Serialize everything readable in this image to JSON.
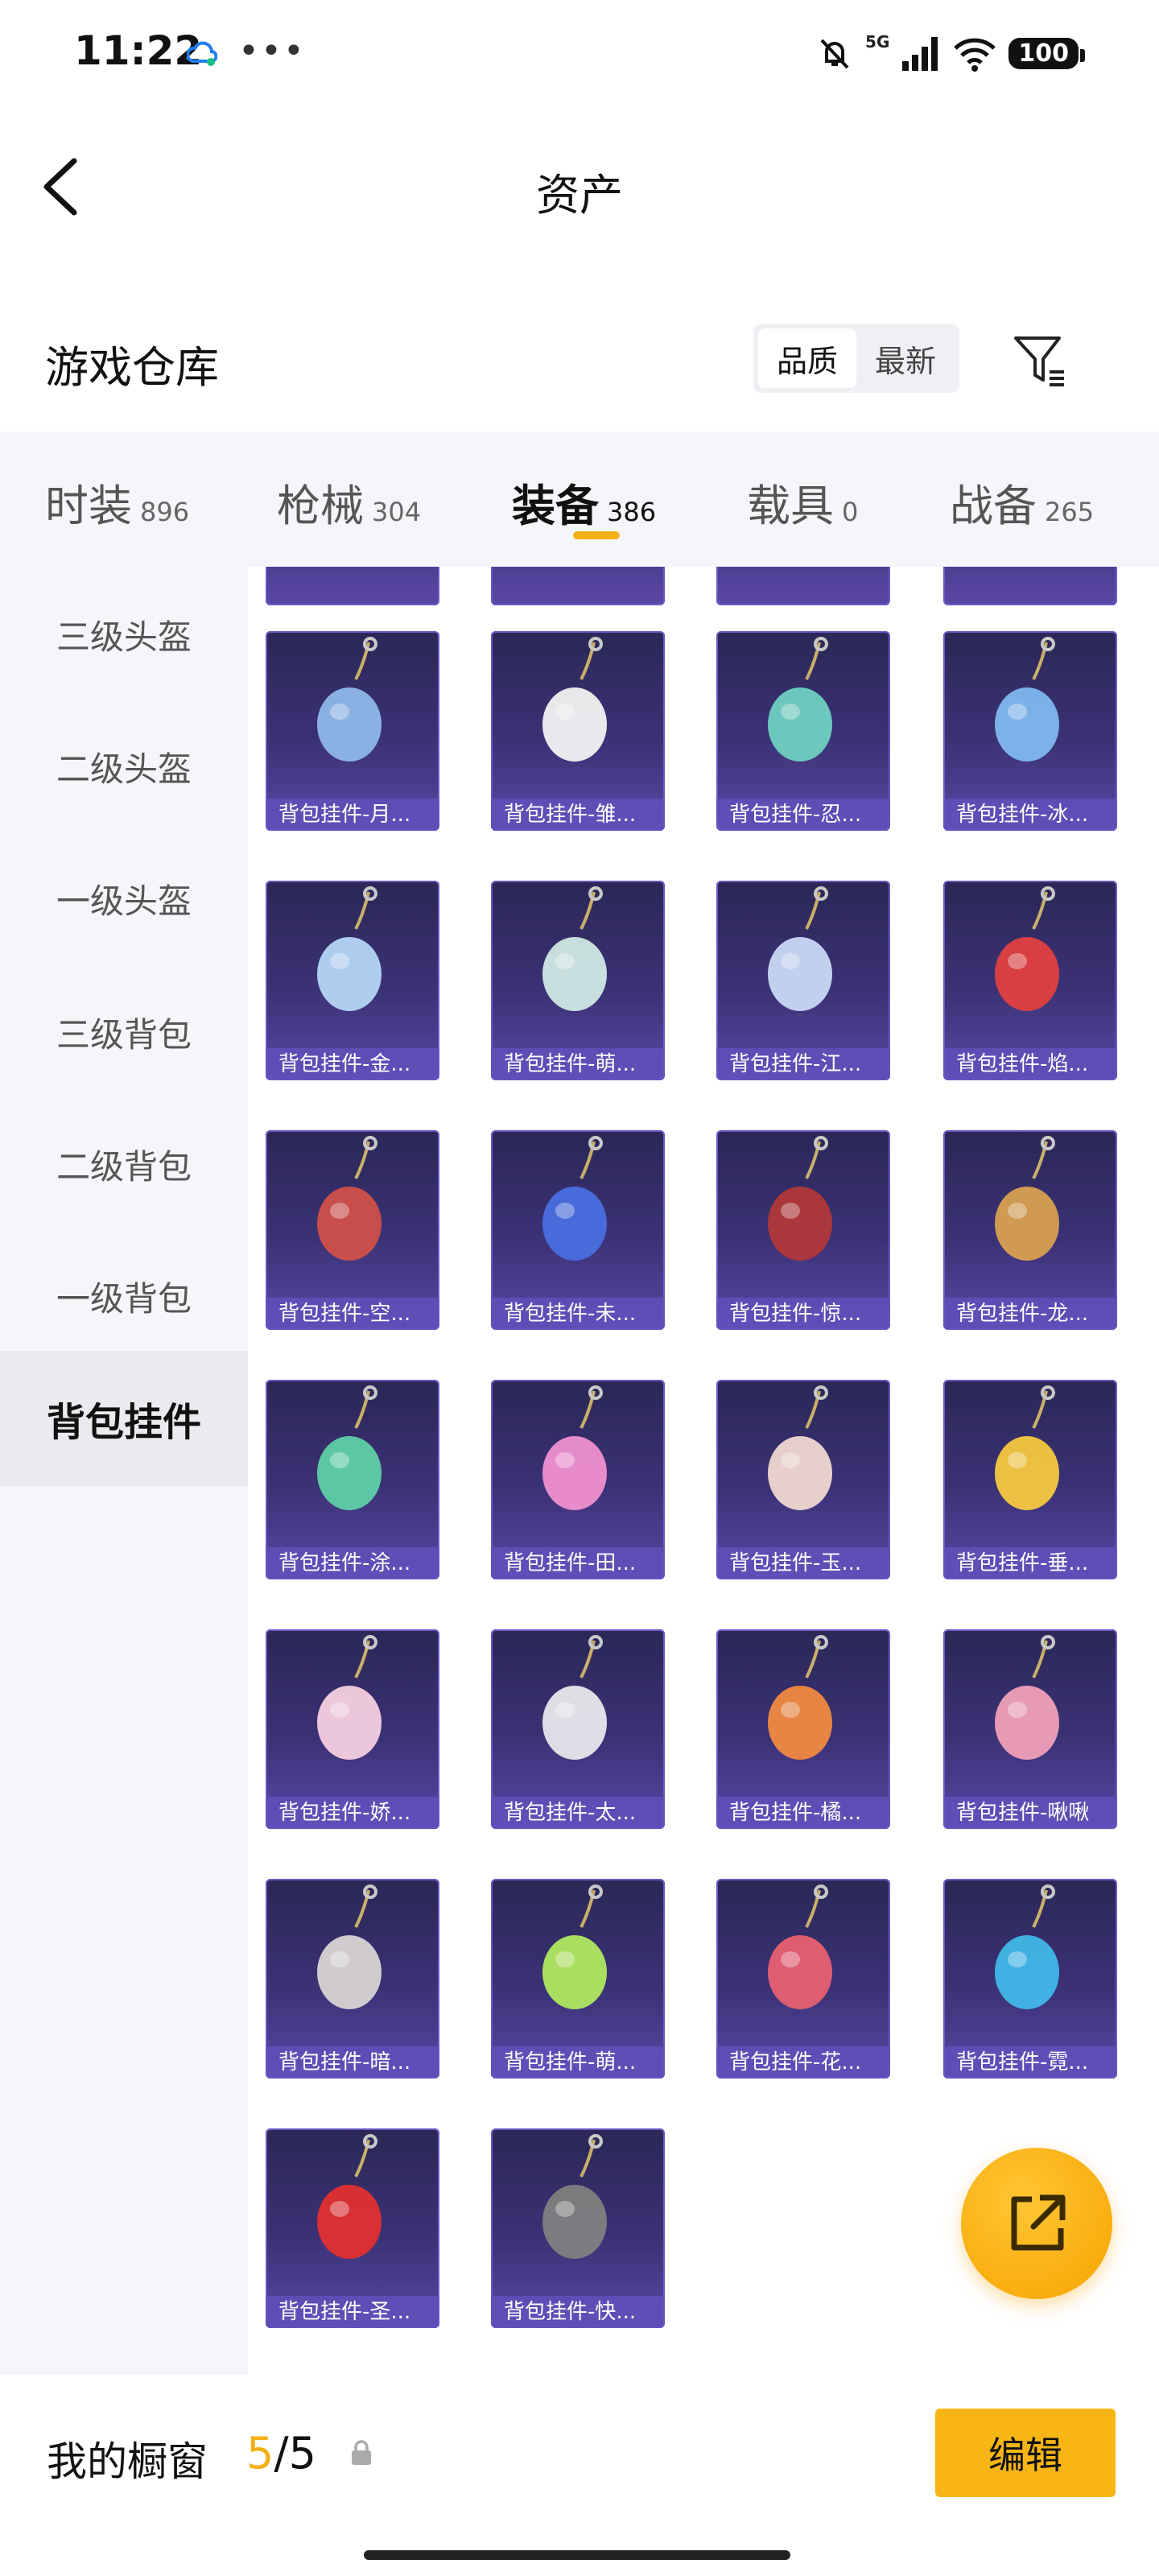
{
  "status": {
    "time": "11:22",
    "network": "5G",
    "battery": "100"
  },
  "header": {
    "title": "资产"
  },
  "warehouse": {
    "title": "游戏仓库",
    "sort_options": [
      "品质",
      "最新"
    ],
    "active_sort": 0
  },
  "categories": [
    {
      "label": "时装",
      "count": "896"
    },
    {
      "label": "枪械",
      "count": "304"
    },
    {
      "label": "装备",
      "count": "386"
    },
    {
      "label": "载具",
      "count": "0"
    },
    {
      "label": "战备",
      "count": "265"
    }
  ],
  "active_category": 2,
  "sidebar": {
    "items": [
      "三级头盔",
      "二级头盔",
      "一级头盔",
      "三级背包",
      "二级背包",
      "一级背包",
      "背包挂件"
    ],
    "active": 6
  },
  "items": [
    {
      "name": "背包挂件-月...",
      "icon": "charm-sword-icon"
    },
    {
      "name": "背包挂件-雏...",
      "icon": "charm-bunny-icon"
    },
    {
      "name": "背包挂件-忍...",
      "icon": "charm-shuriken-icon"
    },
    {
      "name": "背包挂件-冰...",
      "icon": "charm-robot-icon"
    },
    {
      "name": "背包挂件-金...",
      "icon": "charm-scroll-icon"
    },
    {
      "name": "背包挂件-萌...",
      "icon": "charm-bottle-icon"
    },
    {
      "name": "背包挂件-江...",
      "icon": "charm-flower-icon"
    },
    {
      "name": "背包挂件-焰...",
      "icon": "charm-knot-icon"
    },
    {
      "name": "背包挂件-空...",
      "icon": "charm-pistol-icon"
    },
    {
      "name": "背包挂件-未...",
      "icon": "charm-heart-bow-icon"
    },
    {
      "name": "背包挂件-惊...",
      "icon": "charm-tassel-icon"
    },
    {
      "name": "背包挂件-龙...",
      "icon": "charm-lion-icon"
    },
    {
      "name": "背包挂件-涂...",
      "icon": "charm-swirl-icon"
    },
    {
      "name": "背包挂件-田...",
      "icon": "charm-card-icon"
    },
    {
      "name": "背包挂件-玉...",
      "icon": "charm-rabbit-icon"
    },
    {
      "name": "背包挂件-垂...",
      "icon": "charm-duck-icon"
    },
    {
      "name": "背包挂件-娇...",
      "icon": "charm-bun-icon"
    },
    {
      "name": "背包挂件-太...",
      "icon": "charm-astronaut-icon"
    },
    {
      "name": "背包挂件-橘...",
      "icon": "charm-heart-icon"
    },
    {
      "name": "背包挂件-啾啾",
      "icon": "charm-bird-icon"
    },
    {
      "name": "背包挂件-暗...",
      "icon": "charm-voodoo-bunny-icon"
    },
    {
      "name": "背包挂件-萌...",
      "icon": "charm-sprout-icon"
    },
    {
      "name": "背包挂件-花...",
      "icon": "charm-amulet-icon"
    },
    {
      "name": "背包挂件-霓...",
      "icon": "charm-cake-icon"
    },
    {
      "name": "背包挂件-圣...",
      "icon": "charm-santa-hat-icon"
    },
    {
      "name": "背包挂件-快...",
      "icon": "charm-helmet-face-icon"
    }
  ],
  "bottom": {
    "label": "我的橱窗",
    "current": "5",
    "separator": "/",
    "total": "5",
    "edit_label": "编辑"
  },
  "colors": {
    "accent": "#f5b016",
    "card_top": "#2b2756",
    "card_bottom": "#5b47a6"
  }
}
